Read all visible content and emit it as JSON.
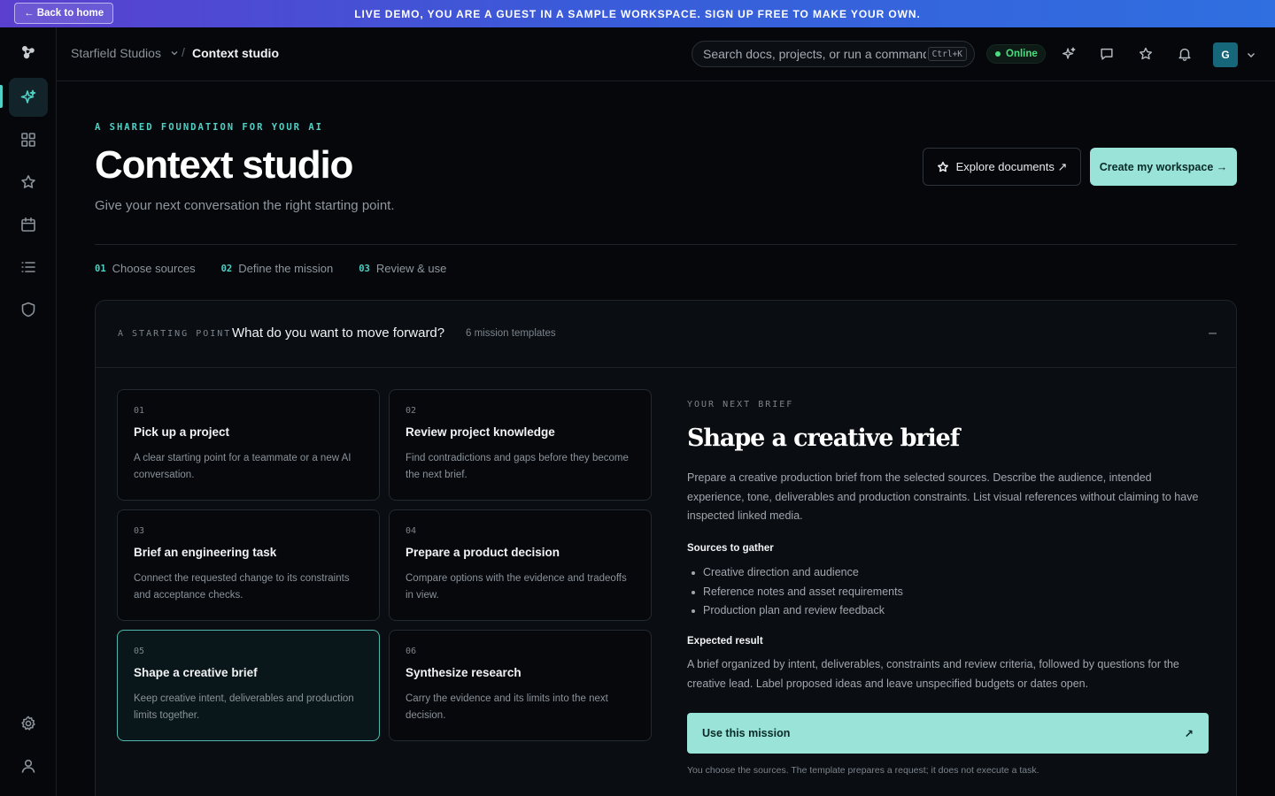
{
  "banner": {
    "back_label": "← Back to home",
    "text": "LIVE DEMO, YOU ARE A GUEST IN A SAMPLE WORKSPACE. SIGN UP FREE TO MAKE YOUR OWN."
  },
  "rail": {
    "items": [
      "logo-icon",
      "sparkles-icon",
      "grid-icon",
      "star-icon",
      "calendar-icon",
      "list-icon",
      "shield-icon"
    ],
    "bottom": [
      "gear-icon",
      "user-icon"
    ],
    "active": "sparkles-icon"
  },
  "topbar": {
    "org": "Starfield Studios",
    "page": "Context studio",
    "search_placeholder": "Search docs, projects, or run a command",
    "shortcut": "Ctrl+K",
    "status": "Online",
    "avatar_initial": "G"
  },
  "header": {
    "eyebrow": "A SHARED FOUNDATION FOR YOUR AI",
    "title": "Context studio",
    "subtitle": "Give your next conversation the right starting point.",
    "explore_label": "Explore documents ↗",
    "create_label": "Create my workspace →"
  },
  "steps": [
    {
      "num": "01",
      "label": "Choose sources"
    },
    {
      "num": "02",
      "label": "Define the mission"
    },
    {
      "num": "03",
      "label": "Review & use"
    }
  ],
  "panel": {
    "kicker": "A STARTING POINT",
    "question": "What do you want to move forward?",
    "count": "6 mission templates",
    "collapse": "–"
  },
  "templates": [
    {
      "num": "01",
      "title": "Pick up a project",
      "desc": "A clear starting point for a teammate or a new AI conversation."
    },
    {
      "num": "02",
      "title": "Review project knowledge",
      "desc": "Find contradictions and gaps before they become the next brief."
    },
    {
      "num": "03",
      "title": "Brief an engineering task",
      "desc": "Connect the requested change to its constraints and acceptance checks."
    },
    {
      "num": "04",
      "title": "Prepare a product decision",
      "desc": "Compare options with the evidence and tradeoffs in view."
    },
    {
      "num": "05",
      "title": "Shape a creative brief",
      "desc": "Keep creative intent, deliverables and production limits together.",
      "selected": true
    },
    {
      "num": "06",
      "title": "Synthesize research",
      "desc": "Carry the evidence and its limits into the next decision."
    }
  ],
  "brief": {
    "kicker": "YOUR NEXT BRIEF",
    "title": "Shape a creative brief",
    "description": "Prepare a creative production brief from the selected sources. Describe the audience, intended experience, tone, deliverables and production constraints. List visual references without claiming to have inspected linked media.",
    "sources_heading": "Sources to gather",
    "sources": [
      "Creative direction and audience",
      "Reference notes and asset requirements",
      "Production plan and review feedback"
    ],
    "result_heading": "Expected result",
    "result": "A brief organized by intent, deliverables, constraints and review criteria, followed by questions for the creative lead. Label proposed ideas and leave unspecified budgets or dates open.",
    "use_label": "Use this mission",
    "use_icon": "↗",
    "footnote": "You choose the sources. The template prepares a request; it does not execute a task."
  },
  "colors": {
    "accent": "#4fd1c5",
    "primary_button": "#99e3d8",
    "online": "#4ade80",
    "banner_start": "#5b3fcf",
    "banner_end": "#2f6fe0"
  }
}
